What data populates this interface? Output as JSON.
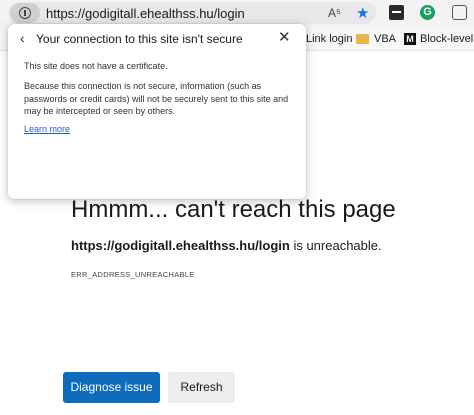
{
  "address_bar": {
    "url": "https://godigitall.ehealthss.hu/login",
    "read_aloud_label": "A⁵",
    "info_icon": "info-icon"
  },
  "toolbar": {
    "favorite_icon": "star-icon",
    "extension_icons": [
      "extension-icon",
      "grammarly-icon",
      "collections-icon"
    ]
  },
  "favorites": {
    "items": [
      {
        "label": "Link login"
      },
      {
        "label": "VBA",
        "icon": "folder-icon"
      },
      {
        "label": "Block-level e",
        "icon": "m-logo-icon"
      }
    ]
  },
  "security_popup": {
    "title": "Your connection to this site isn't secure",
    "paragraph1": "This site does not have a certificate.",
    "paragraph2": "Because this connection is not secure, information (such as passwords or credit cards) will not be securely sent to this site and may be intercepted or seen by others.",
    "link": "Learn more"
  },
  "error_page": {
    "heading": "Hmmm... can't reach this page",
    "host": "https://godigitall.ehealthss.hu/login",
    "suffix": " is unreachable.",
    "code": "ERR_ADDRESS_UNREACHABLE",
    "diagnose_label": "Diagnose issue",
    "refresh_label": "Refresh",
    "accent_color": "#0f6cbd"
  }
}
